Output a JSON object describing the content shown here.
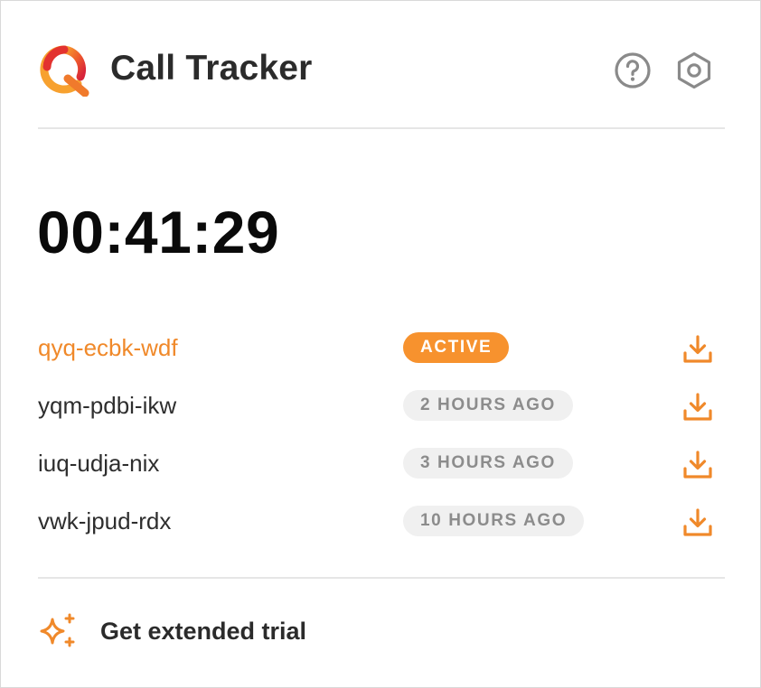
{
  "app": {
    "title": "Call Tracker",
    "logo_icon": "q-logo-icon",
    "brand_colors": [
      "#e8322f",
      "#f7922e"
    ]
  },
  "header": {
    "help_icon": "help-circle-icon",
    "settings_icon": "hexagon-settings-icon",
    "icon_color": "#8a8a8a"
  },
  "timer": {
    "value": "00:41:29"
  },
  "calls": [
    {
      "id": "qyq-ecbk-wdf",
      "status": "ACTIVE",
      "active": true,
      "action_icon": "download-icon"
    },
    {
      "id": "yqm-pdbi-ikw",
      "status": "2 HOURS AGO",
      "active": false,
      "action_icon": "download-icon"
    },
    {
      "id": "iuq-udja-nix",
      "status": "3 HOURS AGO",
      "active": false,
      "action_icon": "download-icon"
    },
    {
      "id": "vwk-jpud-rdx",
      "status": "10 HOURS AGO",
      "active": false,
      "action_icon": "download-icon"
    }
  ],
  "footer": {
    "label": "Get extended trial",
    "icon": "sparkles-icon"
  },
  "colors": {
    "accent": "#f7922e",
    "active_text": "#f0892a",
    "muted_badge_bg": "#f0f0f0",
    "muted_badge_text": "#8c8c8c"
  }
}
